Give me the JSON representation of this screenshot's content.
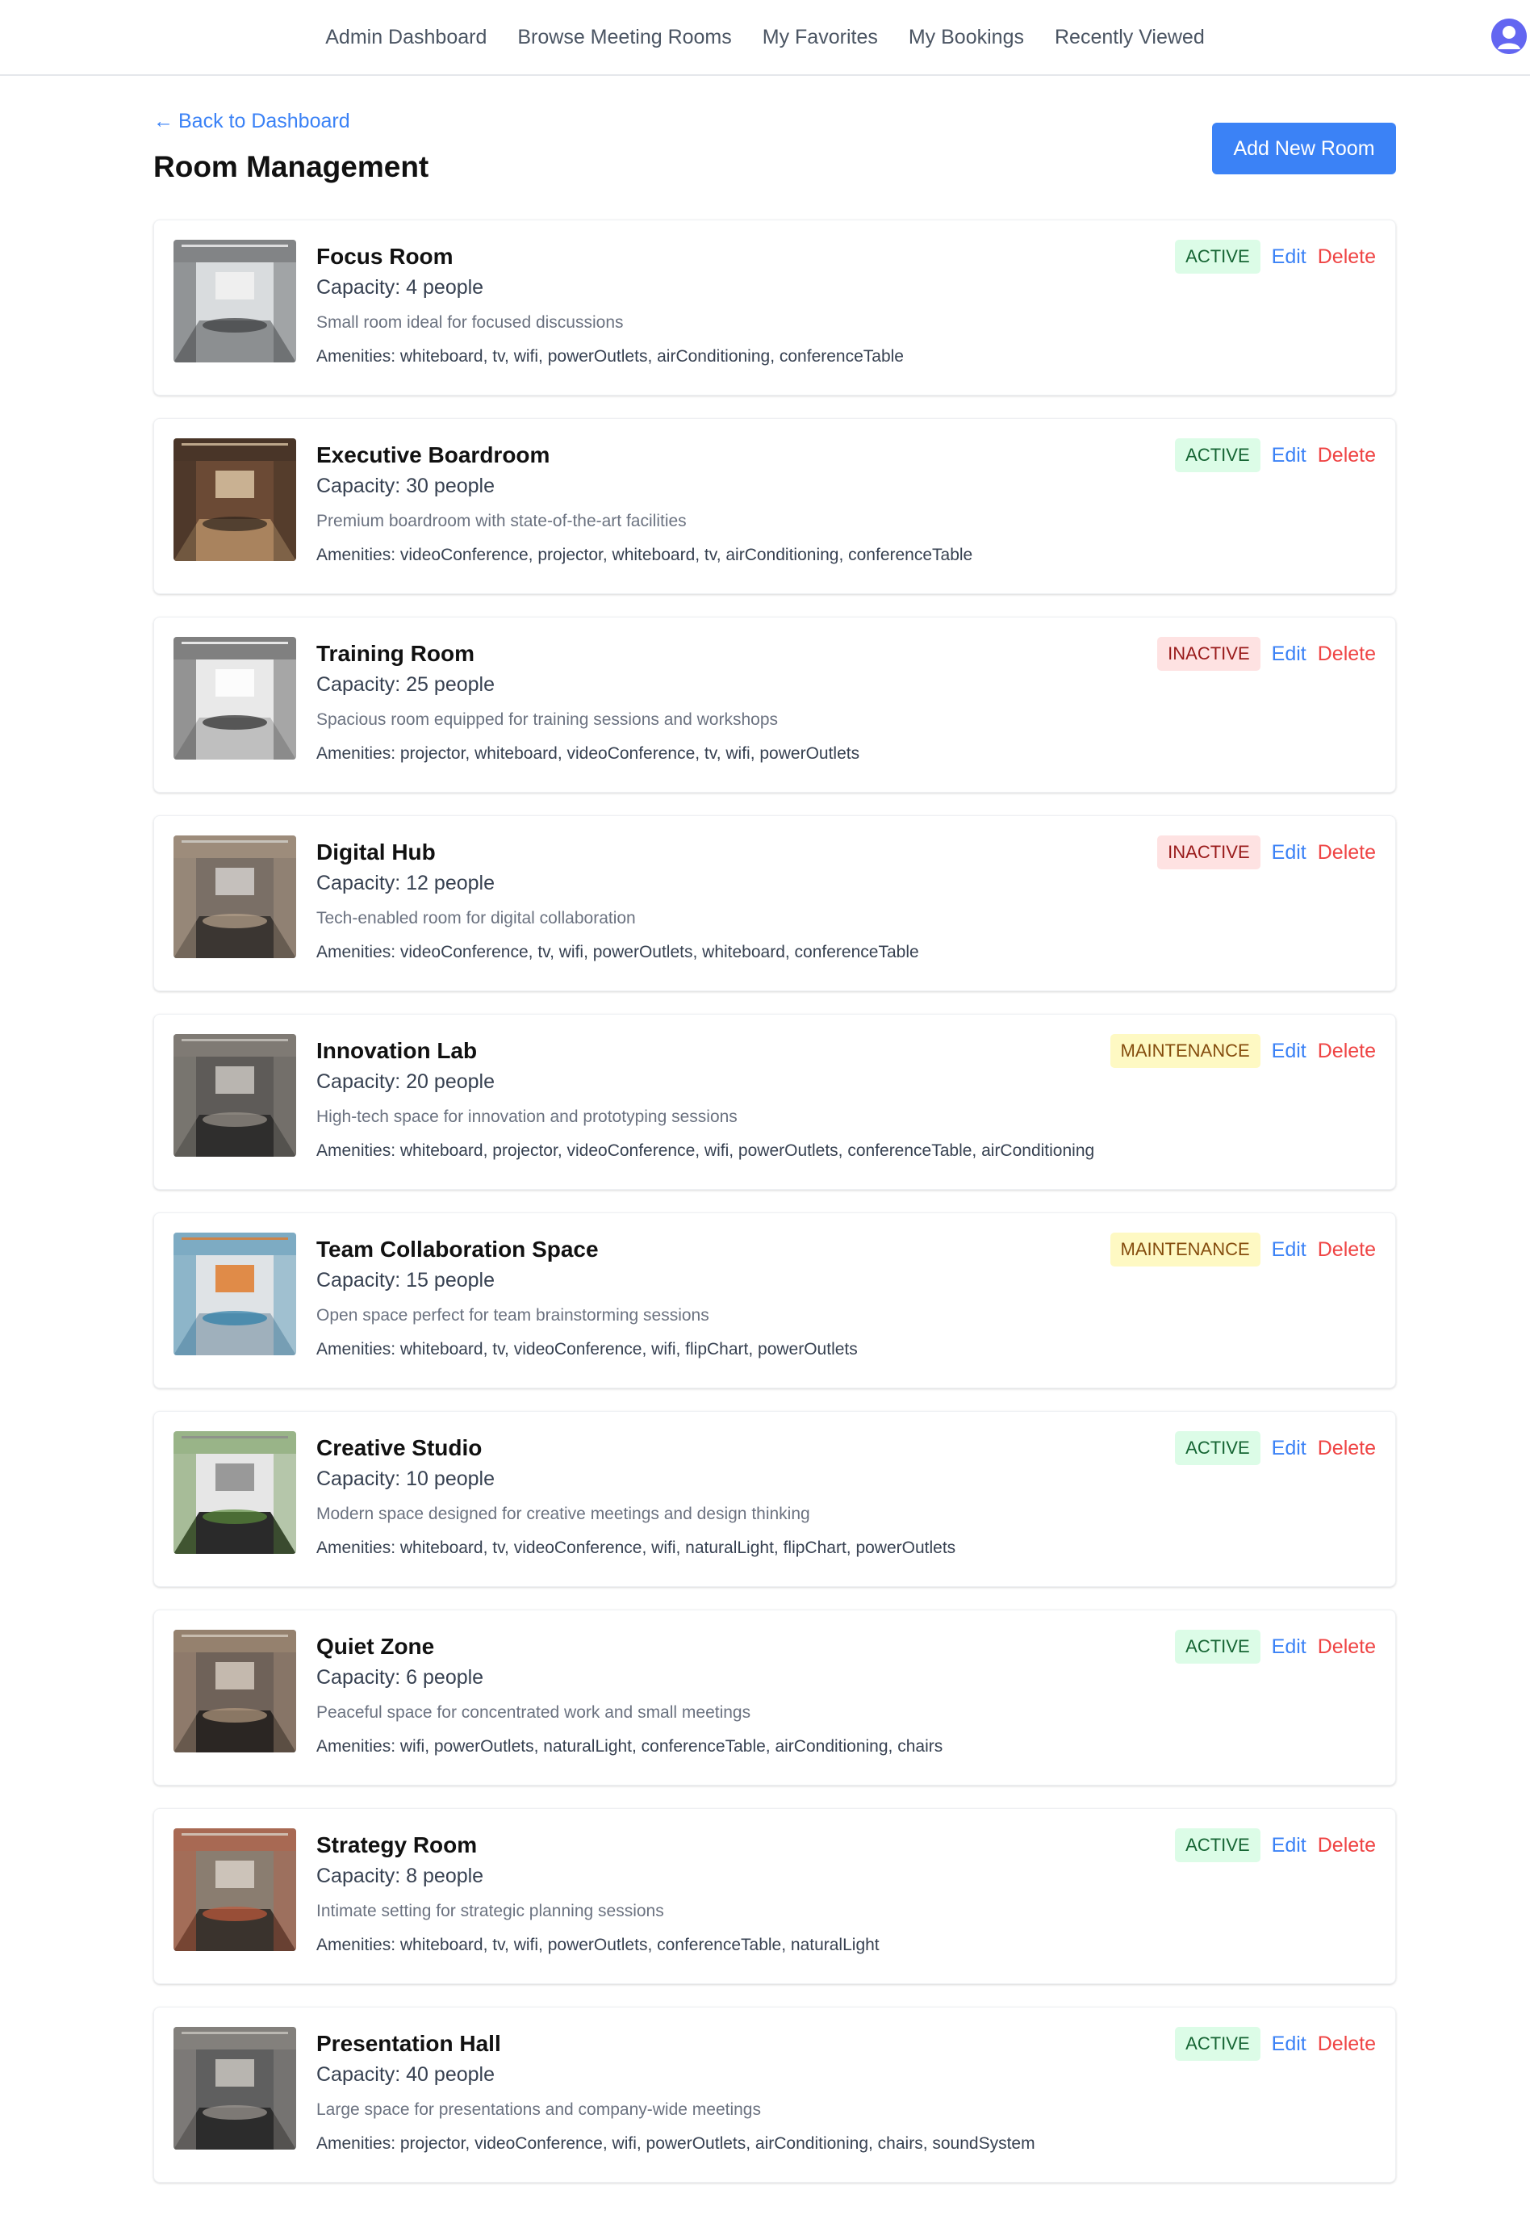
{
  "nav": {
    "links": [
      "Admin Dashboard",
      "Browse Meeting Rooms",
      "My Favorites",
      "My Bookings",
      "Recently Viewed"
    ],
    "avatar_icon": "user-avatar-icon"
  },
  "page": {
    "back_link": "Back to Dashboard",
    "back_arrow": "←",
    "title": "Room Management",
    "add_button": "Add New Room"
  },
  "colors": {
    "accent": "#3b82f6",
    "danger": "#ef4444",
    "active_bg": "#dcfce7",
    "inactive_bg": "#fee2e2",
    "maintenance_bg": "#fef9c3"
  },
  "rooms": [
    {
      "name": "Focus Room",
      "capacity": "Capacity: 4 people",
      "description": "Small room ideal for focused discussions",
      "amenities": "Amenities: whiteboard, tv, wifi, powerOutlets, airConditioning, conferenceTable",
      "status": "ACTIVE",
      "status_type": "active",
      "edit": "Edit",
      "delete": "Delete"
    },
    {
      "name": "Executive Boardroom",
      "capacity": "Capacity: 30 people",
      "description": "Premium boardroom with state-of-the-art facilities",
      "amenities": "Amenities: videoConference, projector, whiteboard, tv, airConditioning, conferenceTable",
      "status": "ACTIVE",
      "status_type": "active",
      "edit": "Edit",
      "delete": "Delete"
    },
    {
      "name": "Training Room",
      "capacity": "Capacity: 25 people",
      "description": "Spacious room equipped for training sessions and workshops",
      "amenities": "Amenities: projector, whiteboard, videoConference, tv, wifi, powerOutlets",
      "status": "INACTIVE",
      "status_type": "inactive",
      "edit": "Edit",
      "delete": "Delete"
    },
    {
      "name": "Digital Hub",
      "capacity": "Capacity: 12 people",
      "description": "Tech-enabled room for digital collaboration",
      "amenities": "Amenities: videoConference, tv, wifi, powerOutlets, whiteboard, conferenceTable",
      "status": "INACTIVE",
      "status_type": "inactive",
      "edit": "Edit",
      "delete": "Delete"
    },
    {
      "name": "Innovation Lab",
      "capacity": "Capacity: 20 people",
      "description": "High-tech space for innovation and prototyping sessions",
      "amenities": "Amenities: whiteboard, projector, videoConference, wifi, powerOutlets, conferenceTable, airConditioning",
      "status": "MAINTENANCE",
      "status_type": "maintenance",
      "edit": "Edit",
      "delete": "Delete"
    },
    {
      "name": "Team Collaboration Space",
      "capacity": "Capacity: 15 people",
      "description": "Open space perfect for team brainstorming sessions",
      "amenities": "Amenities: whiteboard, tv, videoConference, wifi, flipChart, powerOutlets",
      "status": "MAINTENANCE",
      "status_type": "maintenance",
      "edit": "Edit",
      "delete": "Delete"
    },
    {
      "name": "Creative Studio",
      "capacity": "Capacity: 10 people",
      "description": "Modern space designed for creative meetings and design thinking",
      "amenities": "Amenities: whiteboard, tv, videoConference, wifi, naturalLight, flipChart, powerOutlets",
      "status": "ACTIVE",
      "status_type": "active",
      "edit": "Edit",
      "delete": "Delete"
    },
    {
      "name": "Quiet Zone",
      "capacity": "Capacity: 6 people",
      "description": "Peaceful space for concentrated work and small meetings",
      "amenities": "Amenities: wifi, powerOutlets, naturalLight, conferenceTable, airConditioning, chairs",
      "status": "ACTIVE",
      "status_type": "active",
      "edit": "Edit",
      "delete": "Delete"
    },
    {
      "name": "Strategy Room",
      "capacity": "Capacity: 8 people",
      "description": "Intimate setting for strategic planning sessions",
      "amenities": "Amenities: whiteboard, tv, wifi, powerOutlets, conferenceTable, naturalLight",
      "status": "ACTIVE",
      "status_type": "active",
      "edit": "Edit",
      "delete": "Delete"
    },
    {
      "name": "Presentation Hall",
      "capacity": "Capacity: 40 people",
      "description": "Large space for presentations and company-wide meetings",
      "amenities": "Amenities: projector, videoConference, wifi, powerOutlets, airConditioning, chairs, soundSystem",
      "status": "ACTIVE",
      "status_type": "active",
      "edit": "Edit",
      "delete": "Delete"
    }
  ]
}
